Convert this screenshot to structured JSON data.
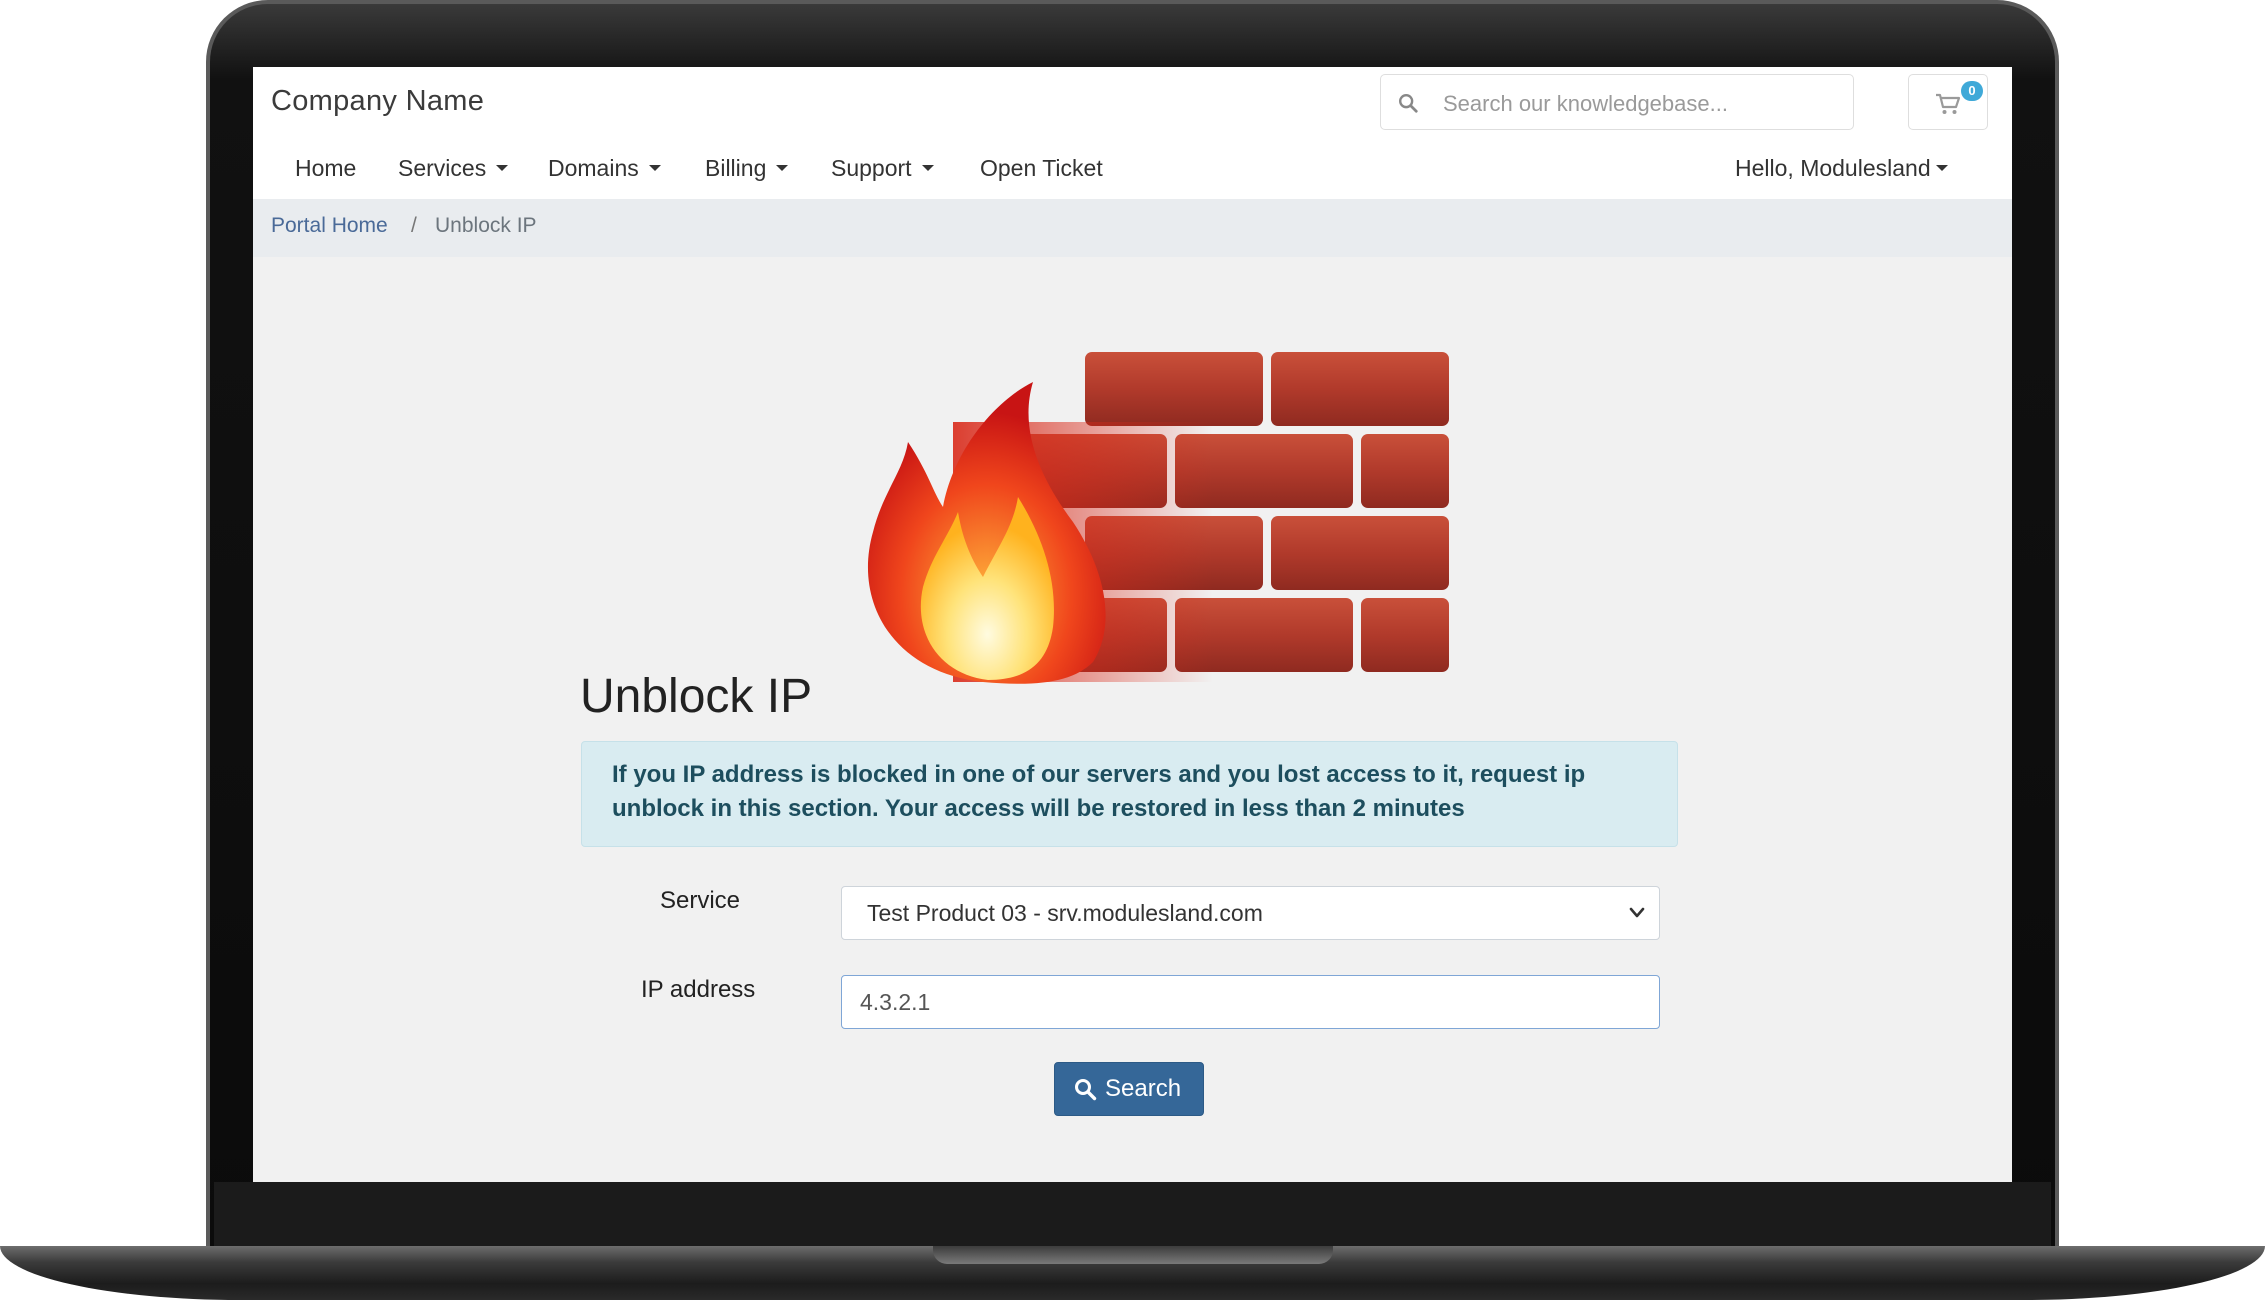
{
  "header": {
    "brand": "Company Name",
    "search_placeholder": "Search our knowledgebase...",
    "cart_count": "0"
  },
  "nav": {
    "items": [
      {
        "label": "Home"
      },
      {
        "label": "Services"
      },
      {
        "label": "Domains"
      },
      {
        "label": "Billing"
      },
      {
        "label": "Support"
      },
      {
        "label": "Open Ticket"
      }
    ],
    "user_menu": "Hello, Modulesland"
  },
  "breadcrumb": {
    "home": "Portal Home",
    "separator": "/",
    "current": "Unblock IP"
  },
  "page": {
    "title": "Unblock IP",
    "alert_line1": "If you IP address is blocked in one of our servers and you lost access to it, request ip",
    "alert_line2": "unblock in this section. Your access will be restored in less than 2 minutes"
  },
  "form": {
    "service_label": "Service",
    "service_value": "Test Product 03 - srv.modulesland.com",
    "ip_label": "IP address",
    "ip_value": "4.3.2.1",
    "submit_label": "Search"
  },
  "colors": {
    "primary_button": "#356798",
    "alert_bg": "#d9ecf1",
    "link": "#4a6a98",
    "badge": "#3fa9d8"
  }
}
